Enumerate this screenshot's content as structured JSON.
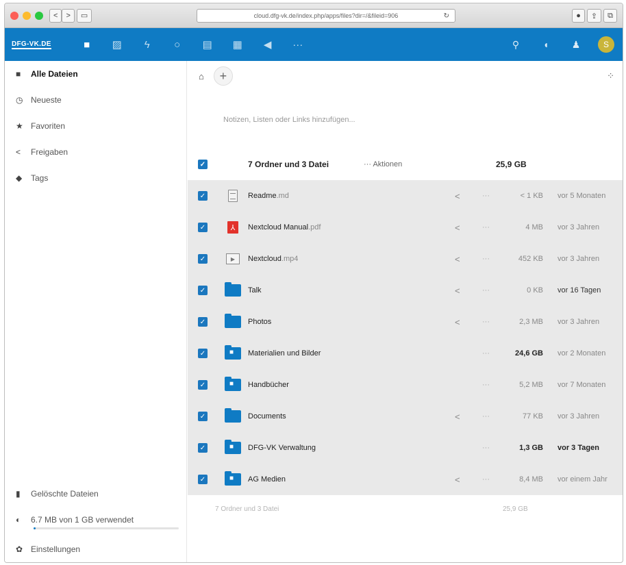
{
  "browser": {
    "url": "cloud.dfg-vk.de/index.php/apps/files?dir=/&fileid=906",
    "back": "<",
    "forward": ">",
    "sidebar_btn": "▭",
    "reload": "↻",
    "right_buttons": [
      "●",
      "⇪",
      "⧉"
    ]
  },
  "header": {
    "logo": "DFG-VK.DE",
    "apps": [
      {
        "name": "files",
        "glyph": "■"
      },
      {
        "name": "photos",
        "glyph": "▨"
      },
      {
        "name": "activity",
        "glyph": "ϟ"
      },
      {
        "name": "search-app",
        "glyph": "○"
      },
      {
        "name": "calendar",
        "glyph": "▤"
      },
      {
        "name": "deck",
        "glyph": "▦"
      },
      {
        "name": "announcements",
        "glyph": "◀"
      },
      {
        "name": "more-apps",
        "glyph": "···"
      }
    ],
    "right": [
      {
        "name": "search",
        "glyph": "⚲"
      },
      {
        "name": "notifications",
        "glyph": "◖"
      },
      {
        "name": "contacts",
        "glyph": "♟"
      }
    ],
    "avatar_letter": "S"
  },
  "sidebar": {
    "items": [
      {
        "label": "Alle Dateien",
        "glyph": "■"
      },
      {
        "label": "Neueste",
        "glyph": "◷"
      },
      {
        "label": "Favoriten",
        "glyph": "★"
      },
      {
        "label": "Freigaben",
        "glyph": "<"
      },
      {
        "label": "Tags",
        "glyph": "◆"
      }
    ],
    "trash_label": "Gelöschte Dateien",
    "quota_label": "6.7 MB von 1 GB verwendet",
    "quota_fraction": 0.0067,
    "settings_label": "Einstellungen"
  },
  "main": {
    "home_glyph": "⌂",
    "plus": "+",
    "grid_glyph": "⁘",
    "notes_placeholder": "Notizen, Listen oder Links hinzufügen...",
    "header": {
      "summary": "7 Ordner und 3 Datei",
      "actions": "··· Aktionen",
      "size": "25,9 GB"
    },
    "files": [
      {
        "name": "Readme",
        "ext": ".md",
        "icon": "doc",
        "share": true,
        "more": "···",
        "size": "< 1 KB",
        "modified": "vor 5 Monaten",
        "size_bold": false,
        "mod_style": ""
      },
      {
        "name": "Nextcloud Manual",
        "ext": ".pdf",
        "icon": "pdf",
        "share": true,
        "more": "···",
        "size": "4 MB",
        "modified": "vor 3 Jahren",
        "size_bold": false,
        "mod_style": ""
      },
      {
        "name": "Nextcloud",
        "ext": ".mp4",
        "icon": "video",
        "share": true,
        "more": "···",
        "size": "452 KB",
        "modified": "vor 3 Jahren",
        "size_bold": false,
        "mod_style": ""
      },
      {
        "name": "Talk",
        "ext": "",
        "icon": "folder",
        "share": true,
        "more": "···",
        "size": "0 KB",
        "modified": "vor 16 Tagen",
        "size_bold": false,
        "mod_style": "dark"
      },
      {
        "name": "Photos",
        "ext": "",
        "icon": "folder",
        "share": true,
        "more": "···",
        "size": "2,3 MB",
        "modified": "vor 3 Jahren",
        "size_bold": false,
        "mod_style": ""
      },
      {
        "name": "Materialien und Bilder",
        "ext": "",
        "icon": "folder-shared",
        "share": false,
        "more": "···",
        "size": "24,6 GB",
        "modified": "vor 2 Monaten",
        "size_bold": true,
        "mod_style": ""
      },
      {
        "name": "Handbücher",
        "ext": "",
        "icon": "folder-shared",
        "share": false,
        "more": "···",
        "size": "5,2 MB",
        "modified": "vor 7 Monaten",
        "size_bold": false,
        "mod_style": ""
      },
      {
        "name": "Documents",
        "ext": "",
        "icon": "folder",
        "share": true,
        "more": "···",
        "size": "77 KB",
        "modified": "vor 3 Jahren",
        "size_bold": false,
        "mod_style": ""
      },
      {
        "name": "DFG-VK Verwaltung",
        "ext": "",
        "icon": "folder-shared",
        "share": false,
        "more": "···",
        "size": "1,3 GB",
        "modified": "vor 3 Tagen",
        "size_bold": true,
        "mod_style": "bold"
      },
      {
        "name": "AG Medien",
        "ext": "",
        "icon": "folder-shared",
        "share": true,
        "more": "···",
        "size": "8,4 MB",
        "modified": "vor einem Jahr",
        "size_bold": false,
        "mod_style": ""
      }
    ],
    "footer": {
      "summary": "7 Ordner und 3 Datei",
      "size": "25,9 GB"
    }
  }
}
